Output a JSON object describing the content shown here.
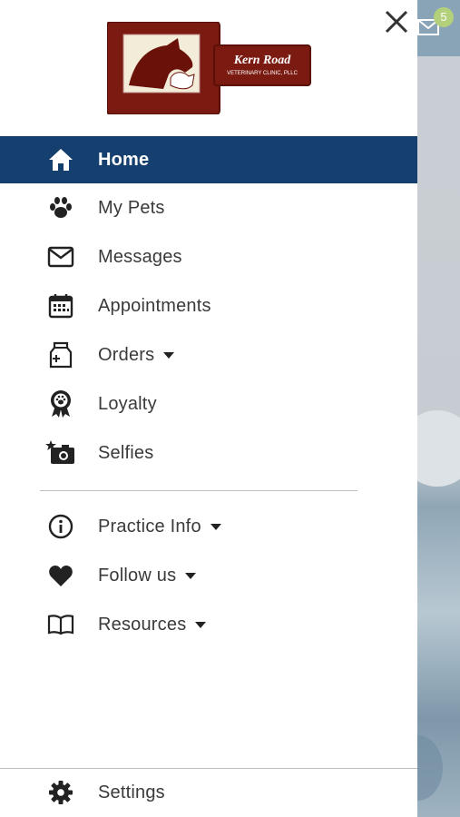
{
  "background": {
    "badge_count": "5",
    "accent": "#8aa4b7"
  },
  "drawer": {
    "logo": {
      "title": "Kern Road",
      "subtitle": "VETERINARY CLINIC, PLLC"
    },
    "menu": [
      {
        "label": "Home",
        "icon": "home-icon",
        "active": true
      },
      {
        "label": "My Pets",
        "icon": "paw-icon"
      },
      {
        "label": "Messages",
        "icon": "envelope-icon"
      },
      {
        "label": "Appointments",
        "icon": "calendar-icon"
      },
      {
        "label": "Orders",
        "icon": "food-bag-icon",
        "expandable": true
      },
      {
        "label": "Loyalty",
        "icon": "award-ribbon-icon"
      },
      {
        "label": "Selfies",
        "icon": "camera-star-icon"
      }
    ],
    "menu_secondary": [
      {
        "label": "Practice Info",
        "icon": "info-icon",
        "expandable": true
      },
      {
        "label": "Follow us",
        "icon": "heart-icon",
        "expandable": true
      },
      {
        "label": "Resources",
        "icon": "book-icon",
        "expandable": true
      }
    ],
    "settings": {
      "label": "Settings",
      "icon": "gear-icon"
    },
    "colors": {
      "active_bg": "#143f6e",
      "text": "#3a3a3a",
      "logo_red": "#7a1a10"
    }
  }
}
